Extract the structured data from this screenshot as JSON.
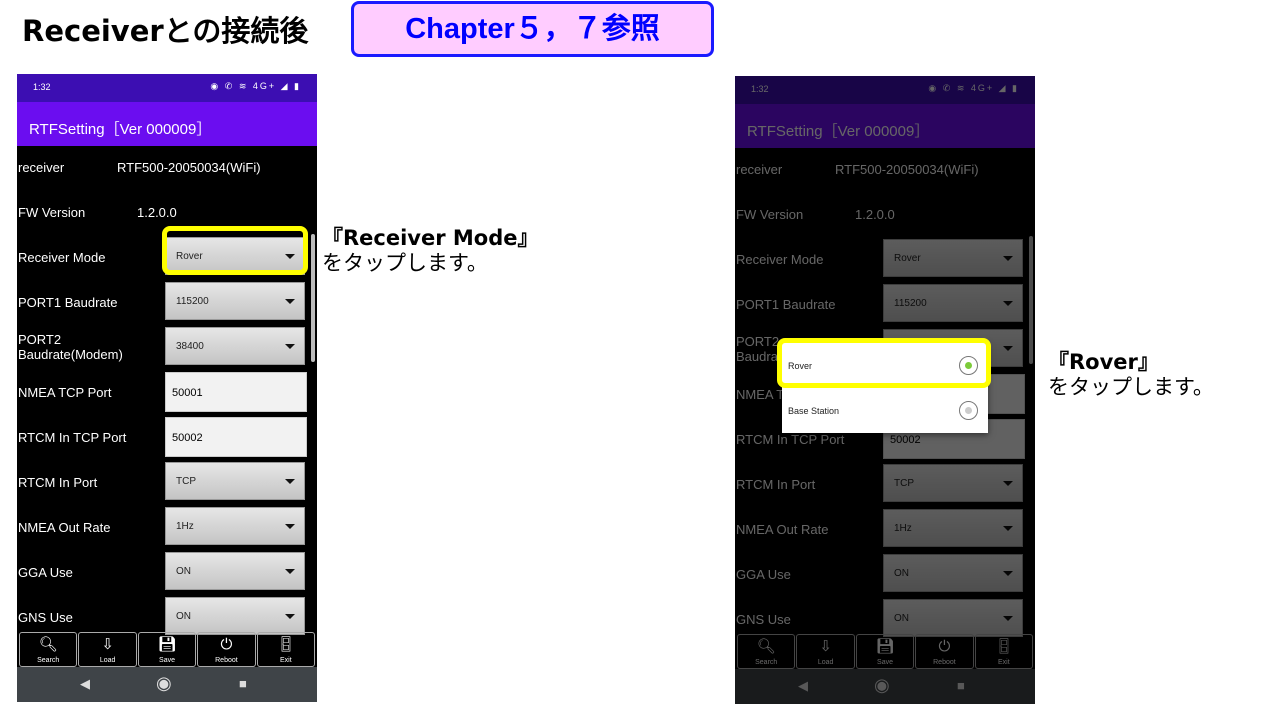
{
  "header": {
    "title": "Receiverとの接続後",
    "badge": "Chapter５，７参照"
  },
  "notes": {
    "left_bold": "『Receiver Mode』",
    "left_text": "をタップします。",
    "right_bold": "『Rover』",
    "right_text": "をタップします。"
  },
  "phone": {
    "time": "1:32",
    "status_icons": "◉ ✆ ≋ 4G+ ◢ ▮",
    "app_title": "RTFSetting［Ver 000009］",
    "rows": [
      {
        "label": "receiver",
        "type": "text",
        "value": "RTF500-20050034(WiFi)"
      },
      {
        "label": "FW Version",
        "type": "text",
        "value": "1.2.0.0"
      },
      {
        "label": "Receiver Mode",
        "type": "select",
        "value": "Rover"
      },
      {
        "label": "PORT1 Baudrate",
        "type": "select",
        "value": "115200"
      },
      {
        "label": "PORT2 Baudrate(Modem)",
        "type": "select",
        "value": "38400"
      },
      {
        "label": "NMEA TCP Port",
        "type": "input",
        "value": "50001"
      },
      {
        "label": "RTCM In TCP Port",
        "type": "input",
        "value": "50002"
      },
      {
        "label": "RTCM In Port",
        "type": "select",
        "value": "TCP"
      },
      {
        "label": "NMEA Out Rate",
        "type": "select",
        "value": "1Hz"
      },
      {
        "label": "GGA Use",
        "type": "select",
        "value": "ON"
      },
      {
        "label": "GNS Use",
        "type": "select",
        "value": "ON"
      }
    ],
    "toolbar": [
      {
        "label": "Search",
        "icon": "search-icon",
        "glyph": "🔍︎"
      },
      {
        "label": "Load",
        "icon": "load-icon",
        "glyph": "⇩"
      },
      {
        "label": "Save",
        "icon": "save-icon",
        "glyph": "💾︎"
      },
      {
        "label": "Reboot",
        "icon": "power-icon",
        "glyph": "⏻"
      },
      {
        "label": "Exit",
        "icon": "exit-icon",
        "glyph": "🚪︎"
      }
    ]
  },
  "popup": {
    "options": [
      {
        "label": "Rover",
        "selected": true
      },
      {
        "label": "Base Station",
        "selected": false
      }
    ]
  },
  "colors": {
    "status_bar": "#3c0eb2",
    "app_bar": "#6b0df0",
    "highlight": "#ffff00",
    "badge_bg": "#ffccff",
    "badge_text": "#0000ff"
  }
}
